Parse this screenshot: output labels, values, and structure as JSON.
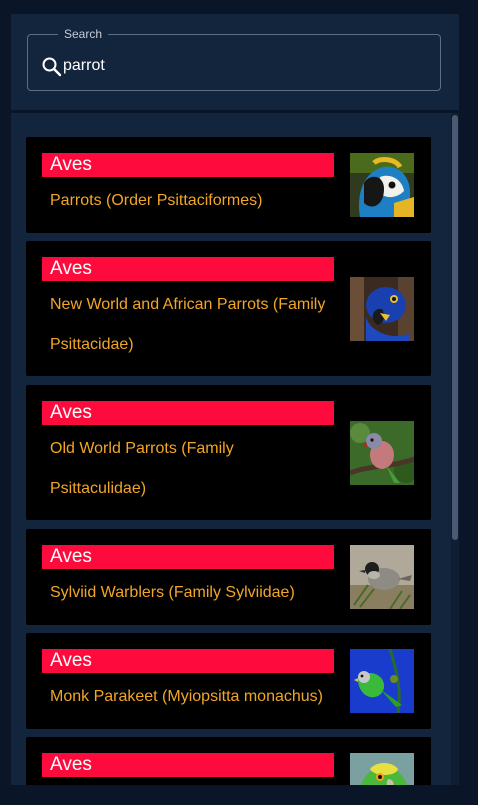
{
  "search": {
    "legend": "Search",
    "value": "parrot"
  },
  "results": [
    {
      "class": "Aves",
      "title": "Parrots (Order Psittaciformes)",
      "image": "macaw-photo"
    },
    {
      "class": "Aves",
      "title": "New World and African Parrots (Family Psittacidae)",
      "image": "hyacinth-macaw-photo"
    },
    {
      "class": "Aves",
      "title": "Old World Parrots (Family Psittaculidae)",
      "image": "parakeet-on-branch-photo"
    },
    {
      "class": "Aves",
      "title": "Sylviid Warblers (Family Sylviidae)",
      "image": "warbler-photo"
    },
    {
      "class": "Aves",
      "title": "Monk Parakeet (Myiopsitta monachus)",
      "image": "monk-parakeet-photo"
    },
    {
      "class": "Aves",
      "title": "",
      "image": "amazon-parrot-photo"
    }
  ],
  "colors": {
    "background": "#0a1628",
    "panel": "#13243d",
    "badge": "#ff0a3c",
    "title": "#f2a628",
    "card": "#000000"
  }
}
